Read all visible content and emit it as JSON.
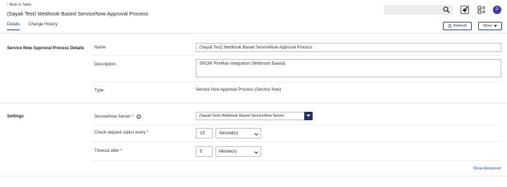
{
  "header": {
    "back_label": "Back to Tasks",
    "title": "(Sayali Test) Webhook Based ServiceNow Approval Process",
    "avatar_initial": "P"
  },
  "search": {
    "placeholder": ""
  },
  "tabs": [
    {
      "label": "Details",
      "active": true
    },
    {
      "label": "Change History",
      "active": false
    }
  ],
  "toolbar": {
    "refresh_label": "Refresh",
    "more_label": "More"
  },
  "details_section": {
    "title": "Service Now Approval Process Details",
    "name_label": "Name",
    "name_value": "(Sayali Test) Webhook Based ServiceNow Approval Process",
    "description_label": "Description",
    "description_value": "SNOW PrivMan Integration (Webhook Based)",
    "type_label": "Type",
    "type_value": "Service Now Approval Process (Service Now)"
  },
  "settings_section": {
    "title": "Settings",
    "server_label": "ServiceNow Server *",
    "server_value": "(Sayali Test) Webhook Based ServiceNow Server",
    "check_label": "Check request status every *",
    "check_value": "15",
    "check_unit": "Second(s)",
    "timeout_label": "Timeout after *",
    "timeout_value": "5",
    "timeout_unit": "Minute(s)"
  },
  "show_advanced_label": "Show Advanced",
  "colors": {
    "accent": "#1e3d8f",
    "dropdown_caret": "#25306b",
    "avatar": "#3b3ba0"
  }
}
